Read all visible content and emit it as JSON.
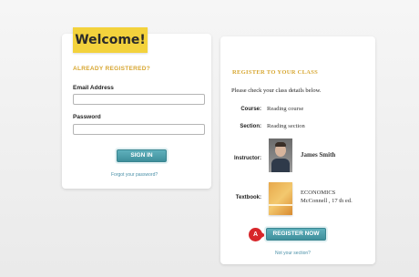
{
  "login": {
    "welcome": "Welcome!",
    "heading": "ALREADY REGISTERED?",
    "email_label": "Email Address",
    "email_value": "",
    "password_label": "Password",
    "password_value": "",
    "signin_label": "SIGN IN",
    "forgot_link": "Forgot your password?"
  },
  "register": {
    "heading": "REGISTER TO YOUR CLASS",
    "instructions": "Please check your class details below.",
    "course_label": "Course:",
    "course_value": "Reading course",
    "section_label": "Section:",
    "section_value": "Reading section",
    "instructor_label": "Instructor:",
    "instructor_name": "James Smith",
    "textbook_label": "Textbook:",
    "textbook_title": "ECONOMICS",
    "textbook_edition": "McConnell , 17 th ed.",
    "register_label": "REGISTER NOW",
    "not_section_link": "Not your section?",
    "step_badge": "A"
  },
  "colors": {
    "accent_teal": "#4a9ea9",
    "banner_yellow": "#f3d23c",
    "heading_gold": "#d7a630",
    "badge_red": "#d7262a"
  },
  "icons": {
    "instructor_photo": "person-photo",
    "textbook_cover": "book-cover-image",
    "step_arrow": "arrow-right-icon"
  }
}
